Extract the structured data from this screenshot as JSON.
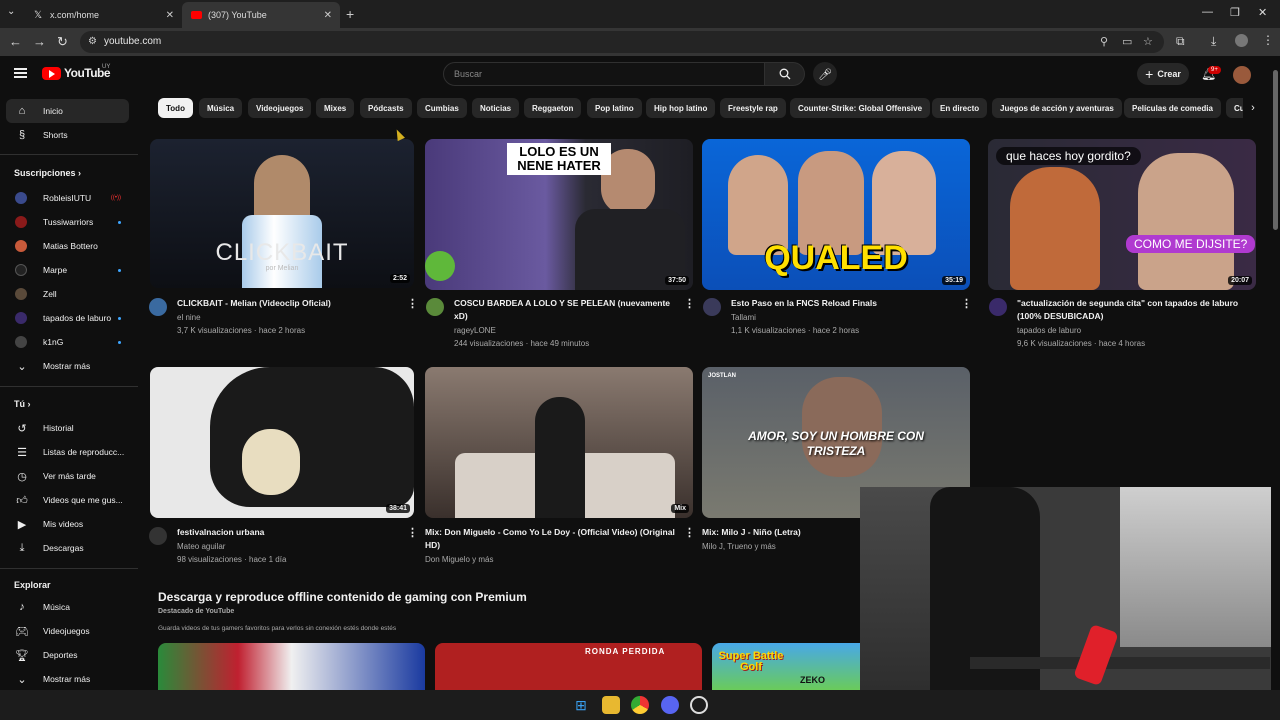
{
  "browser": {
    "tabs": [
      {
        "label": "x.com/home"
      },
      {
        "label": "(307) YouTube"
      }
    ],
    "url": "youtube.com"
  },
  "header": {
    "logo_text": "YouTube",
    "country_code": "UY",
    "search_placeholder": "Buscar",
    "create_label": "Crear",
    "notif_count": "9+"
  },
  "sidebar": {
    "main": [
      {
        "label": "Inicio"
      },
      {
        "label": "Shorts"
      }
    ],
    "subs_heading": "Suscripciones",
    "subs": [
      {
        "label": "RobleisIUTU",
        "color": "#3a4a8c"
      },
      {
        "label": "Tussiwarriors",
        "color": "#8a1a1a"
      },
      {
        "label": "Matias Bottero",
        "color": "#c85a3a"
      },
      {
        "label": "Marpe",
        "color": "#222222"
      },
      {
        "label": "Zell",
        "color": "#5a4a3a"
      },
      {
        "label": "tapados de laburo",
        "color": "#3a2a6a"
      },
      {
        "label": "k1nG",
        "color": "#444444"
      },
      {
        "label": "Mostrar más"
      }
    ],
    "you_heading": "Tú",
    "you": [
      {
        "label": "Historial"
      },
      {
        "label": "Listas de reproducc..."
      },
      {
        "label": "Ver más tarde"
      },
      {
        "label": "Videos que me gus..."
      },
      {
        "label": "Mis videos"
      },
      {
        "label": "Descargas"
      }
    ],
    "explore_heading": "Explorar",
    "explore": [
      {
        "label": "Música"
      },
      {
        "label": "Videojuegos"
      },
      {
        "label": "Deportes"
      },
      {
        "label": "Mostrar más"
      }
    ]
  },
  "chips": [
    "Todo",
    "Música",
    "Videojuegos",
    "Mixes",
    "Pódcasts",
    "Cumbias",
    "Noticias",
    "Reggaeton",
    "Pop latino",
    "Hip hop latino",
    "Freestyle rap",
    "Counter-Strike: Global Offensive",
    "En directo",
    "Juegos de acción y aventuras",
    "Películas de comedia",
    "Cu"
  ],
  "videos": [
    {
      "title": "CLICKBAIT - Melian (Videoclip Oficial)",
      "channel": "el nine",
      "stats": "3,7 K visualizaciones · hace 2 horas",
      "duration": "2:52",
      "overlay": "CLICKBAIT",
      "overlay_sub": "por Melian"
    },
    {
      "title": "COSCU BARDEA A LOLO Y SE PELEAN (nuevamente xD)",
      "channel": "rageyLONE",
      "stats": "244 visualizaciones · hace 49 minutos",
      "duration": "37:50",
      "overlay": "LOLO ES UN NENE HATER"
    },
    {
      "title": "Esto Paso en la FNCS Reload Finals",
      "channel": "Tallami",
      "stats": "1,1 K visualizaciones · hace 2 horas",
      "duration": "35:19",
      "overlay": "QUALED"
    },
    {
      "title": "\"actualización de segunda cita\" con tapados de laburo (100% DESUBICADA)",
      "channel": "tapados de laburo",
      "stats": "9,6 K visualizaciones · hace 4 horas",
      "duration": "20:07",
      "overlay": "que haces hoy gordito?",
      "overlay_sub": "COMO ME DIJSITE?"
    },
    {
      "title": "festivalnacion urbana",
      "channel": "Mateo aguilar",
      "stats": "98 visualizaciones · hace 1 día",
      "duration": "38:41"
    },
    {
      "title": "Mix: Don Miguelo - Como Yo Le Doy - (Official Video) (Original HD)",
      "channel": "Don Miguelo y más",
      "duration": "Mix"
    },
    {
      "title": "Mix: Milo J - Niño (Letra)",
      "channel": "Milo J, Trueno y más",
      "overlay": "AMOR, SOY UN HOMBRE CON TRISTEZA",
      "overlay_brand": "JOSTLAN"
    }
  ],
  "premium": {
    "title": "Descarga y reproduce offline contenido de gaming con Premium",
    "subtitle": "Destacado de YouTube",
    "desc": "Guarda videos de tus gamers favoritos para verlos sin conexión estés donde estés",
    "thumb_texts": [
      "RONDA PERDIDA",
      "Super Battle Golf",
      "ZEKO"
    ]
  }
}
